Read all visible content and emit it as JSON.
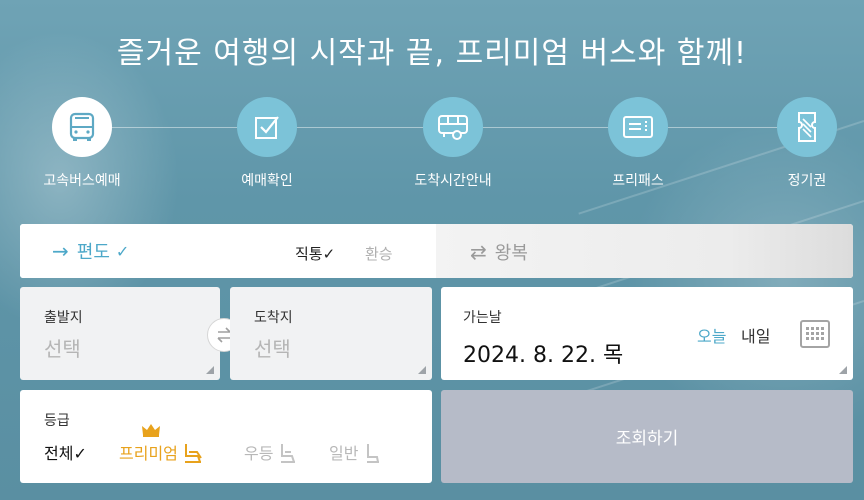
{
  "headline": "즐거운 여행의 시작과 끝, 프리미엄 버스와 함께!",
  "menu": [
    {
      "label": "고속버스예매",
      "icon": "bus-icon",
      "active": true
    },
    {
      "label": "예매확인",
      "icon": "checkbox-icon",
      "active": false
    },
    {
      "label": "도착시간안내",
      "icon": "bus-clock-icon",
      "active": false
    },
    {
      "label": "프리패스",
      "icon": "pass-card-icon",
      "active": false
    },
    {
      "label": "정기권",
      "icon": "ticket-icon",
      "active": false
    }
  ],
  "trip": {
    "oneway_label": "편도",
    "oneway_arrow": "→",
    "oneway_check": "✓",
    "direct_label": "직통✓",
    "transfer_label": "환승",
    "round_label": "왕복",
    "round_icon": "⇄"
  },
  "departure": {
    "label": "출발지",
    "value": "선택"
  },
  "arrival": {
    "label": "도착지",
    "value": "선택"
  },
  "date": {
    "label": "가는날",
    "value": "2024. 8. 22. 목",
    "today_label": "오늘",
    "tomorrow_label": "내일"
  },
  "grade": {
    "label": "등급",
    "options": {
      "all": "전체✓",
      "premium": "프리미엄",
      "deluxe": "우등",
      "normal": "일반"
    }
  },
  "search_label": "조회하기",
  "colors": {
    "accent": "#4da8c9",
    "premium": "#e8a21c",
    "menu_circle": "#7cc3d8",
    "search_button": "#b6bbc8"
  }
}
